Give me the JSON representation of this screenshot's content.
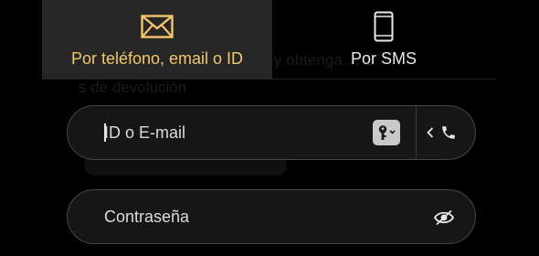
{
  "tabs": [
    {
      "label": "Por teléfono, email o ID",
      "icon": "envelope-icon",
      "active": true
    },
    {
      "label": "Por SMS",
      "icon": "phone-icon",
      "active": false
    }
  ],
  "login": {
    "id_placeholder": "ID o E-mail",
    "password_placeholder": "Contraseña",
    "key_icon": "key-icon",
    "switch_icon": "phone-icon",
    "visibility_icon": "eye-off-icon"
  },
  "colors": {
    "accent": "#f3c66b",
    "background": "#000000",
    "active_tab_bg": "#262626",
    "field_bg": "#161616",
    "field_border": "#454545"
  }
}
